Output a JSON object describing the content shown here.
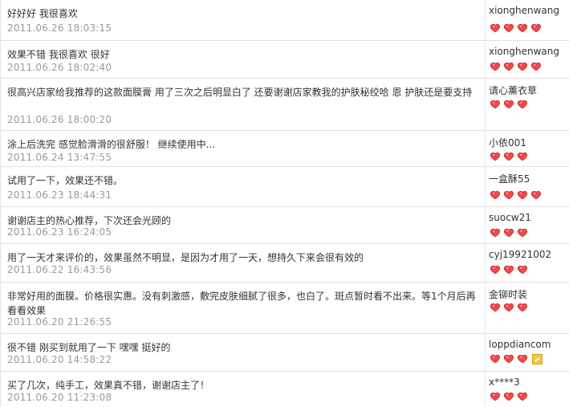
{
  "reviews": [
    {
      "text": "好好好 我很喜欢",
      "date": "2011.06.26 18:03:15",
      "user": "xionghenwang",
      "hearts": 4
    },
    {
      "text": "效果不错 我很喜欢 很好",
      "date": "2011.06.26 18:02:40",
      "user": "xionghenwang",
      "hearts": 4
    },
    {
      "text": "很高兴店家给我推荐的这款面膜膏 用了三次之后明显白了 还要谢谢店家教我的护肤秘绞哈 恩 护肤还是要支持",
      "date": "2011.06.26 18:00:20",
      "user": "请心薰衣草",
      "hearts": 3
    },
    {
      "text": "涂上后洗完 感觉脸滑滑的很舒服！ 继续使用中...",
      "date": "2011.06.24 13:47:55",
      "user": "小依001",
      "hearts": 3
    },
    {
      "text": "试用了一下，效果还不错。",
      "date": "2011.06.23 18:44:31",
      "user": "一盒酥55",
      "hearts": 4
    },
    {
      "text": "谢谢店主的热心推荐，下次还会光顾的",
      "date": "2011.06.23 16:24:05",
      "user": "suocw21",
      "hearts": 3
    },
    {
      "text": "用了一天才来评价的，效果虽然不明显，是因为才用了一天，想持久下来会很有效的",
      "date": "2011.06.22 16:43:56",
      "user": "cyj19921002",
      "hearts": 3
    },
    {
      "text": "非常好用的面膜。价格很实惠。没有刺激感，敷完皮肤细腻了很多，也白了。斑点暂时看不出来。等1个月后再看看效果",
      "date": "2011.06.20 21:26:55",
      "user": "金铆时装",
      "hearts": 3
    },
    {
      "text": "很不错 刚买到就用了一下 嘿嘿 挺好的",
      "date": "2011.06.20 14:58:22",
      "user": "loppdiancom",
      "hearts": 3,
      "badge": true
    },
    {
      "text": "买了几次，纯手工，效果真不错，谢谢店主了！",
      "date": "2011.06.20 11:23:08",
      "user": "x****3",
      "hearts": 3
    }
  ]
}
